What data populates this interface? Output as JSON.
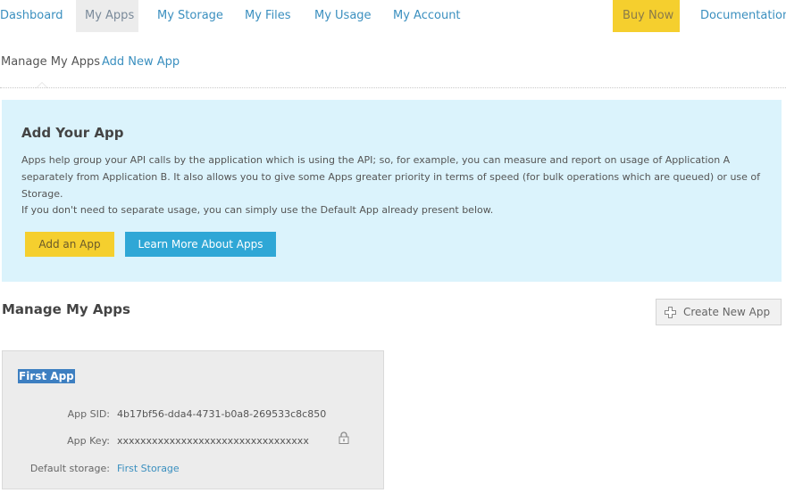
{
  "topnav": {
    "items": [
      {
        "label": "Dashboard"
      },
      {
        "label": "My Apps"
      },
      {
        "label": "My Storage"
      },
      {
        "label": "My Files"
      },
      {
        "label": "My Usage"
      },
      {
        "label": "My Account"
      },
      {
        "label": "Buy Now"
      },
      {
        "label": "Documentation"
      }
    ],
    "active": "My Apps"
  },
  "subnav": {
    "current": "Manage My Apps",
    "link": "Add New App"
  },
  "info": {
    "title": "Add Your App",
    "paragraph1": "Apps help group your API calls by the application which is using the API; so, for example, you can measure and report on usage of Application A separately from Application B. It also allows you to give some Apps greater priority in terms of speed (for bulk operations which are queued) or use of Storage.",
    "paragraph2": "If you don't need to separate usage, you can simply use the Default App already present below.",
    "add_button": "Add an App",
    "learn_button": "Learn More About Apps"
  },
  "manage": {
    "title": "Manage My Apps",
    "create_button": "Create New App"
  },
  "app": {
    "name": "First App",
    "sid_label": "App SID:",
    "sid_value": "4b17bf56-dda4-4731-b0a8-269533c8c850",
    "key_label": "App Key:",
    "key_value": "xxxxxxxxxxxxxxxxxxxxxxxxxxxxxxxxx",
    "storage_label": "Default storage:",
    "storage_value": "First Storage"
  },
  "colors": {
    "link": "#3a8fbf",
    "accent_yellow": "#f5cf2e",
    "accent_blue": "#2fa7d6",
    "panel_bg": "#dbf3fc"
  }
}
